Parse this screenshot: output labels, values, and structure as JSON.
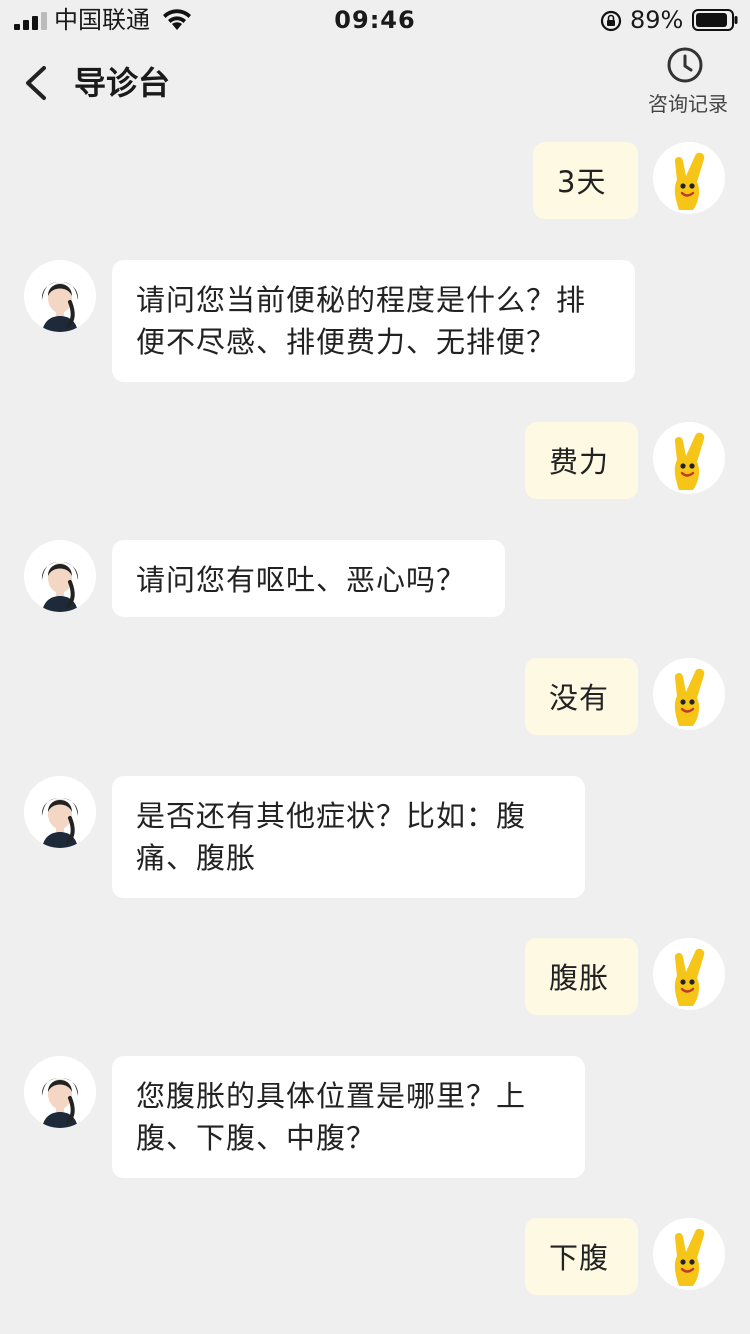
{
  "status_bar": {
    "carrier": "中国联通",
    "time": "09:46",
    "battery": "89%"
  },
  "header": {
    "title": "导诊台",
    "history_label": "咨询记录"
  },
  "messages": [
    {
      "sender": "user",
      "text": "3天"
    },
    {
      "sender": "doctor",
      "text": "请问您当前便秘的程度是什么？排便不尽感、排便费力、无排便？"
    },
    {
      "sender": "user",
      "text": "费力"
    },
    {
      "sender": "doctor",
      "text": "请问您有呕吐、恶心吗？"
    },
    {
      "sender": "user",
      "text": "没有"
    },
    {
      "sender": "doctor",
      "text": "是否还有其他症状？比如：腹痛、腹胀"
    },
    {
      "sender": "user",
      "text": "腹胀"
    },
    {
      "sender": "doctor",
      "text": "您腹胀的具体位置是哪里？上腹、下腹、中腹？"
    },
    {
      "sender": "user",
      "text": "下腹"
    }
  ],
  "colors": {
    "background": "#efefef",
    "user_bubble": "#fdf9e3",
    "doctor_bubble": "#ffffff",
    "user_avatar_accent": "#f5c518"
  }
}
